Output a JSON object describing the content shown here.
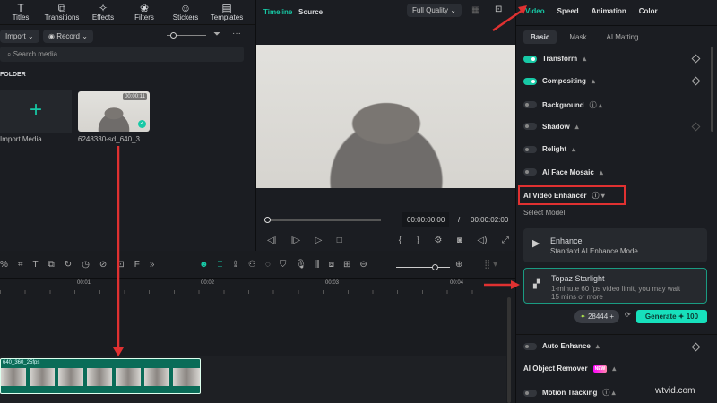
{
  "left_panel": {
    "tabs": [
      {
        "label": "Titles",
        "icon": "T"
      },
      {
        "label": "Transitions",
        "icon": "⧉"
      },
      {
        "label": "Effects",
        "icon": "✧"
      },
      {
        "label": "Filters",
        "icon": "❀"
      },
      {
        "label": "Stickers",
        "icon": "☺"
      },
      {
        "label": "Templates",
        "icon": "▤"
      }
    ],
    "import": "Import",
    "record": "Record",
    "search_placeholder": "Search media",
    "folder": "FOLDER",
    "import_media": "Import Media",
    "media": {
      "name": "6248330-sd_640_3...",
      "duration": "00:00:11"
    }
  },
  "preview": {
    "tabs": [
      "Timeline",
      "Source"
    ],
    "quality": "Full Quality",
    "current_time": "00:00:00:00",
    "separator": "/",
    "total_time": "00:00:02:00"
  },
  "right_panel": {
    "tabs": [
      "Video",
      "Speed",
      "Animation",
      "Color"
    ],
    "subtabs": [
      "Basic",
      "Mask",
      "AI Matting"
    ],
    "props": [
      {
        "label": "Transform",
        "on": true
      },
      {
        "label": "Compositing",
        "on": true
      },
      {
        "label": "Background",
        "on": false
      },
      {
        "label": "Shadow",
        "on": false
      },
      {
        "label": "Relight",
        "on": false
      },
      {
        "label": "AI Face Mosaic",
        "on": false
      }
    ],
    "enhancer_title": "AI Video Enhancer",
    "select_model": "Select Model",
    "models": [
      {
        "title": "Enhance",
        "desc": "Standard AI Enhance Mode"
      },
      {
        "title": "Topaz Starlight",
        "desc": "1-minute 60 fps video limit, you may wait 15 mins or more"
      }
    ],
    "credits": "28444",
    "generate": "Generate",
    "generate_cost": "100",
    "auto_enhance": "Auto Enhance",
    "object_remover": "AI Object Remover",
    "new_badge": "NEW",
    "motion_tracking": "Motion Tracking"
  },
  "timeline": {
    "ruler": [
      "00:01",
      "00:02",
      "00:03",
      "00:04"
    ],
    "clip_name": "640_360_25fps"
  },
  "watermark": "wtvid.com",
  "colors": {
    "accent": "#17c9a6",
    "annotation": "#e03131"
  }
}
